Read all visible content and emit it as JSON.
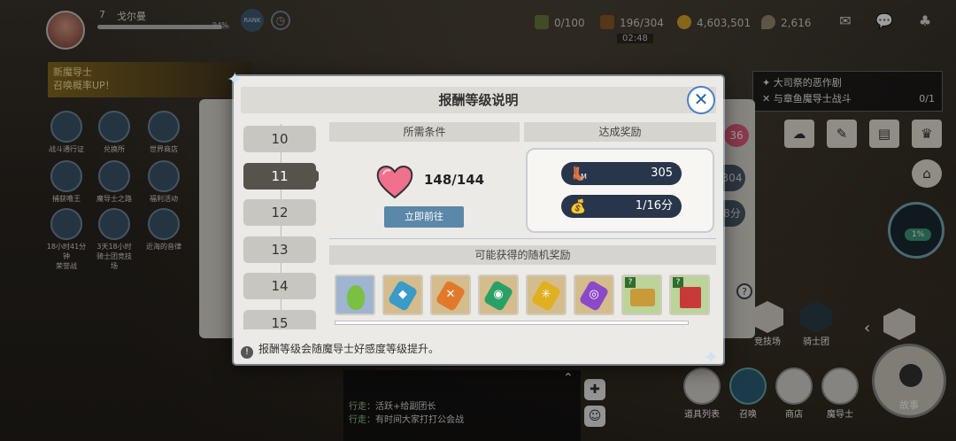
{
  "player": {
    "level": "7",
    "name": "戈尔曼",
    "exp_pct": "94%"
  },
  "top": {
    "rank_label": "RANK",
    "res1": "0/100",
    "res2": "196/304",
    "gold": "4,603,501",
    "gems": "2,616",
    "timer": "02:48"
  },
  "promo": {
    "line1": "新魔导士",
    "line2": "召唤概率UP！"
  },
  "left_icons": [
    {
      "label": "战斗通行证"
    },
    {
      "label": "兑换所"
    },
    {
      "label": "世界商店"
    },
    {
      "label": "捕获噜王"
    },
    {
      "label": "魔导士之路"
    },
    {
      "label": "福利活动"
    },
    {
      "label": "荣誉战",
      "sub": "18小时41分钟"
    },
    {
      "label": "骑士团竞技场",
      "sub": "3天18小时"
    },
    {
      "label": "近海的音律",
      "sub": ""
    }
  ],
  "quest": {
    "title": "大司祭的恶作剧",
    "task": "与章鱼魔导士战斗",
    "count": "0/1"
  },
  "side": {
    "heart_badge": "36",
    "pill1": "304",
    "pill2": "8分",
    "gauge": "1%"
  },
  "modal": {
    "title": "报酬等级说明",
    "levels": [
      "10",
      "11",
      "12",
      "13",
      "14",
      "15"
    ],
    "selected_level": "11",
    "cond_header": "所需条件",
    "reward_header": "达成奖励",
    "progress": "148/144",
    "go_button": "立即前往",
    "rewards": [
      {
        "icon": "boots-icon",
        "sub": "M",
        "value": "305"
      },
      {
        "icon": "money-bag-icon",
        "sub": "",
        "value": "1/16分"
      }
    ],
    "random_header": "可能获得的随机奖励",
    "footer": "报酬等级会随魔导士好感度等级提升。"
  },
  "chat": {
    "line1_tag": "行走：",
    "line1": "活跃+给副团长",
    "line2_tag": "行走：",
    "line2": "有时间大家打打公会战"
  },
  "bottom_nav": {
    "b1": "道具列表",
    "b2": "召唤",
    "b3": "商店",
    "b4": "魔导士",
    "story": "故事",
    "arena": "竞技场",
    "knights": "骑士团"
  },
  "colors": {
    "selected_level": "#56524c",
    "go_button": "#5b87a8",
    "reward_pill": "#28354a",
    "close_border": "#4a82c4"
  }
}
